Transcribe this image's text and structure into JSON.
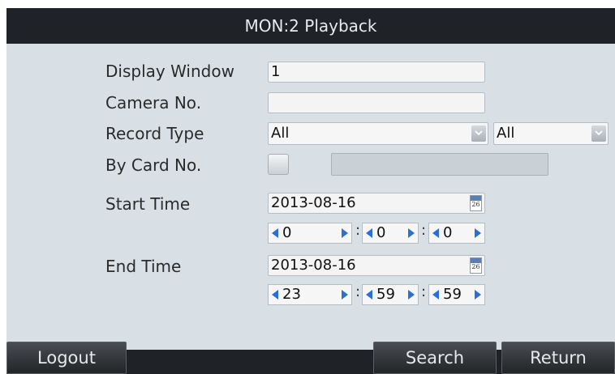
{
  "window": {
    "title": "MON:2 Playback"
  },
  "form": {
    "display_window": {
      "label": "Display Window",
      "value": "1"
    },
    "camera_no": {
      "label": "Camera No.",
      "value": ""
    },
    "record_type": {
      "label": "Record Type",
      "value": "All",
      "sub_value": "All"
    },
    "by_card_no": {
      "label": "By Card No.",
      "checked": false,
      "value": ""
    },
    "start_time": {
      "label": "Start Time",
      "date": "2013-08-16",
      "hour": "0",
      "minute": "0",
      "second": "0"
    },
    "end_time": {
      "label": "End Time",
      "date": "2013-08-16",
      "hour": "23",
      "minute": "59",
      "second": "59"
    },
    "calendar_day": "26",
    "time_separator": ":"
  },
  "buttons": {
    "logout": "Logout",
    "search": "Search",
    "return": "Return"
  },
  "colors": {
    "titlebar": "#1f2226",
    "panel": "#d8e0e6",
    "spin_arrow": "#2a6fd6"
  }
}
